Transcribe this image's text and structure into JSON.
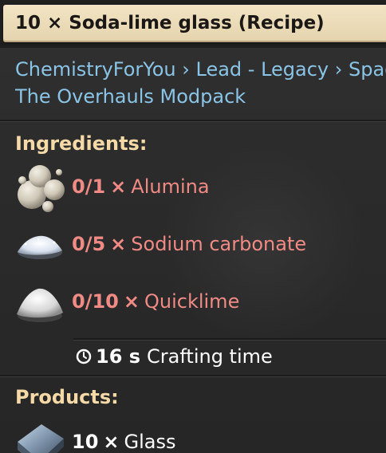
{
  "title": "10 × Soda-lime glass (Recipe)",
  "mods": [
    "ChemistryForYou › Lead - Legacy › Space",
    "The Overhauls Modpack"
  ],
  "ingredients": {
    "heading": "Ingredients:",
    "items": [
      {
        "count": "0/1",
        "times": "×",
        "name": "Alumina",
        "icon": "alumina-icon"
      },
      {
        "count": "0/5",
        "times": "×",
        "name": "Sodium carbonate",
        "icon": "sodium-carbonate-icon"
      },
      {
        "count": "0/10",
        "times": "×",
        "name": "Quicklime",
        "icon": "quicklime-icon"
      }
    ],
    "crafting_time": {
      "value": "16 s",
      "label": "Crafting time",
      "icon": "clock-icon"
    }
  },
  "products": {
    "heading": "Products:",
    "items": [
      {
        "count": "10",
        "times": "×",
        "name": "Glass",
        "icon": "glass-icon"
      }
    ]
  },
  "colors": {
    "title_plate": "#e9dab6",
    "mod_link": "#8ac4e6",
    "heading": "#f5d9a7",
    "missing_ingredient": "#f08a84",
    "product": "#ffffff"
  }
}
